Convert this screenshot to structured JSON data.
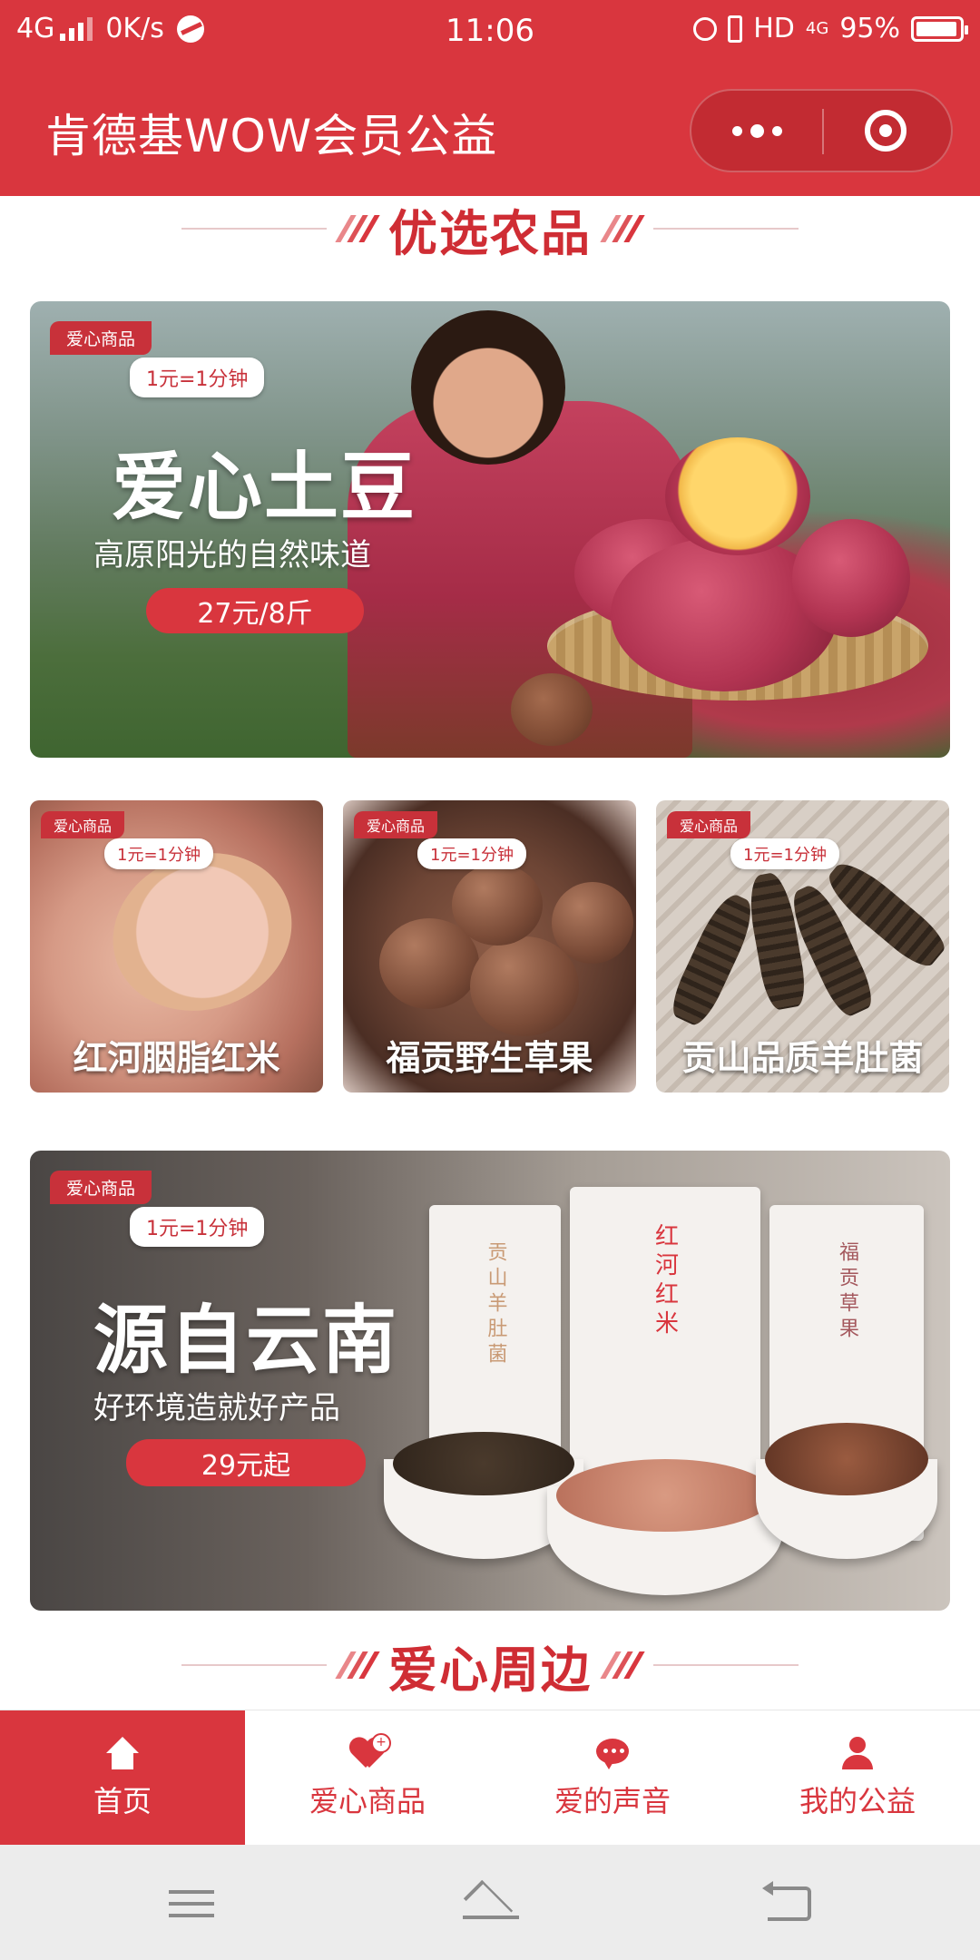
{
  "status_bar": {
    "network": "4G",
    "speed": "0K/s",
    "time": "11:06",
    "hd": "HD",
    "net_type": "4G",
    "battery": "95%",
    "battery_level": 0.95
  },
  "title_bar": {
    "title": "肯德基WOW会员公益",
    "icons": [
      "more-icon",
      "close-icon"
    ]
  },
  "sections": {
    "featured": "优选农品",
    "peripheral": "爱心周边"
  },
  "banners": [
    {
      "tag": "爱心商品",
      "rate": "1元=1分钟",
      "headline": "爱心土豆",
      "subline": "高原阳光的自然味道",
      "price": "27元/8斤"
    },
    {
      "tag": "爱心商品",
      "rate": "1元=1分钟",
      "headline": "源自云南",
      "subline": "好环境造就好产品",
      "price": "29元起",
      "boxes": [
        "贡山羊肚菌",
        "红河红米",
        "福贡草果"
      ]
    }
  ],
  "products": [
    {
      "tag": "爱心商品",
      "rate": "1元=1分钟",
      "title": "红河胭脂红米"
    },
    {
      "tag": "爱心商品",
      "rate": "1元=1分钟",
      "title": "福贡野生草果"
    },
    {
      "tag": "爱心商品",
      "rate": "1元=1分钟",
      "title": "贡山品质羊肚菌"
    }
  ],
  "tabs": [
    {
      "label": "首页",
      "icon": "home-icon",
      "active": true
    },
    {
      "label": "爱心商品",
      "icon": "heart-plus-icon",
      "active": false
    },
    {
      "label": "爱的声音",
      "icon": "chat-icon",
      "active": false
    },
    {
      "label": "我的公益",
      "icon": "user-icon",
      "active": false
    }
  ],
  "colors": {
    "brand_red": "#d9363e",
    "nav_gray": "#ececec"
  }
}
